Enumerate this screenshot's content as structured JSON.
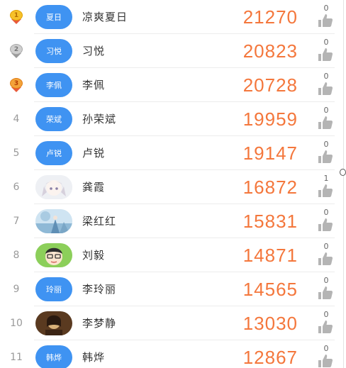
{
  "ranking": {
    "rows": [
      {
        "rank": "1",
        "medal": "gold",
        "avatar_text": "夏日",
        "avatar_type": "text",
        "name": "凉爽夏日",
        "score": "21270",
        "likes": "0"
      },
      {
        "rank": "2",
        "medal": "silver",
        "avatar_text": "习悦",
        "avatar_type": "text",
        "name": "习悦",
        "score": "20823",
        "likes": "0"
      },
      {
        "rank": "3",
        "medal": "bronze",
        "avatar_text": "李佩",
        "avatar_type": "text",
        "name": "李佩",
        "score": "20728",
        "likes": "0"
      },
      {
        "rank": "4",
        "medal": "",
        "avatar_text": "荣斌",
        "avatar_type": "text",
        "name": "孙荣斌",
        "score": "19959",
        "likes": "0"
      },
      {
        "rank": "5",
        "medal": "",
        "avatar_text": "卢锐",
        "avatar_type": "text",
        "name": "卢锐",
        "score": "19147",
        "likes": "0"
      },
      {
        "rank": "6",
        "medal": "",
        "avatar_text": "",
        "avatar_type": "photo-anime-girl",
        "name": "龚霞",
        "score": "16872",
        "likes": "1"
      },
      {
        "rank": "7",
        "medal": "",
        "avatar_text": "",
        "avatar_type": "photo-blue-scene",
        "name": "梁红红",
        "score": "15831",
        "likes": "0"
      },
      {
        "rank": "8",
        "medal": "",
        "avatar_text": "",
        "avatar_type": "photo-green-cartoon",
        "name": "刘毅",
        "score": "14871",
        "likes": "0"
      },
      {
        "rank": "9",
        "medal": "",
        "avatar_text": "玲丽",
        "avatar_type": "text",
        "name": "李玲丽",
        "score": "14565",
        "likes": "0"
      },
      {
        "rank": "10",
        "medal": "",
        "avatar_text": "",
        "avatar_type": "photo-dark-portrait",
        "name": "李梦静",
        "score": "13030",
        "likes": "0"
      },
      {
        "rank": "11",
        "medal": "",
        "avatar_text": "韩烨",
        "avatar_type": "text",
        "name": "韩烨",
        "score": "12867",
        "likes": "0"
      }
    ]
  },
  "icons": {
    "like": "thumbs-up-icon",
    "medal": "medal-icon"
  },
  "colors": {
    "score": "#f4773c",
    "avatar_bg": "#3f93f2",
    "name": "#333333",
    "rank": "#9a9a9a"
  }
}
